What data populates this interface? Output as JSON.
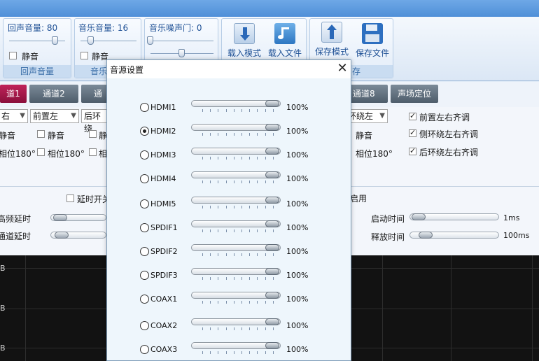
{
  "ribbon": {
    "echo_volume": {
      "label": "回声音量: 80",
      "mute_label": "静音",
      "footer": "回声音量",
      "level": 80
    },
    "music_volume": {
      "label": "音乐音量: 16",
      "mute_label": "静音",
      "footer": "音乐",
      "level": 16
    },
    "music_noise_gate": {
      "label": "音乐噪声门: 0",
      "level": 0
    },
    "load_mode": "载入模式",
    "load_file": "载入文件",
    "save_mode": "保存模式",
    "save_file": "保存文件",
    "save_footer": "存"
  },
  "tabs": [
    {
      "label": "道1",
      "active": true
    },
    {
      "label": "通道2",
      "active": false
    },
    {
      "label": "通",
      "active": false
    },
    {
      "label": "通道8",
      "active": false
    },
    {
      "label": "声场定位",
      "active": false
    }
  ],
  "channels": {
    "col1": {
      "select": "右",
      "mute": "静音",
      "phase": "相位180°"
    },
    "col2": {
      "select": "前置左",
      "mute": "静音",
      "phase": "相位180°"
    },
    "col3": {
      "select": "后环绕",
      "mute": "静",
      "phase": "相"
    },
    "col4": {
      "select": "环绕左",
      "mute": "静音",
      "phase": "相位180°"
    },
    "align": [
      {
        "label": "前置左右齐调",
        "checked": true
      },
      {
        "label": "侧环绕左右齐调",
        "checked": true
      },
      {
        "label": "后环绕左右齐调",
        "checked": true
      }
    ]
  },
  "delay": {
    "delay_switch": "延时开关",
    "highfreq_delay": "高频延时",
    "channel_delay": "通道延时",
    "enable": "启用",
    "attack_time": "启动时间",
    "attack_value": "1ms",
    "release_time": "释放时间",
    "release_value": "100ms"
  },
  "graph": {
    "labels": [
      "B",
      "B",
      "B"
    ]
  },
  "dialog": {
    "title": "音源设置",
    "close": "✕",
    "sources": [
      {
        "name": "HDMI1",
        "percent": "100%",
        "selected": false,
        "level": 100
      },
      {
        "name": "HDMI2",
        "percent": "100%",
        "selected": true,
        "level": 100
      },
      {
        "name": "HDMI3",
        "percent": "100%",
        "selected": false,
        "level": 100
      },
      {
        "name": "HDMI4",
        "percent": "100%",
        "selected": false,
        "level": 100
      },
      {
        "name": "HDMI5",
        "percent": "100%",
        "selected": false,
        "level": 100
      },
      {
        "name": "SPDIF1",
        "percent": "100%",
        "selected": false,
        "level": 100
      },
      {
        "name": "SPDIF2",
        "percent": "100%",
        "selected": false,
        "level": 100
      },
      {
        "name": "SPDIF3",
        "percent": "100%",
        "selected": false,
        "level": 100
      },
      {
        "name": "COAX1",
        "percent": "100%",
        "selected": false,
        "level": 100
      },
      {
        "name": "COAX2",
        "percent": "100%",
        "selected": false,
        "level": 100
      },
      {
        "name": "COAX3",
        "percent": "100%",
        "selected": false,
        "level": 100
      }
    ]
  },
  "colors": {
    "accent_tab": "#a01a4a",
    "ribbon_text": "#1d4f94"
  },
  "icons": {
    "load_mode": "download-arrow-icon",
    "load_file": "music-folder-icon",
    "save_mode": "upload-arrow-icon",
    "save_file": "floppy-disk-icon"
  }
}
